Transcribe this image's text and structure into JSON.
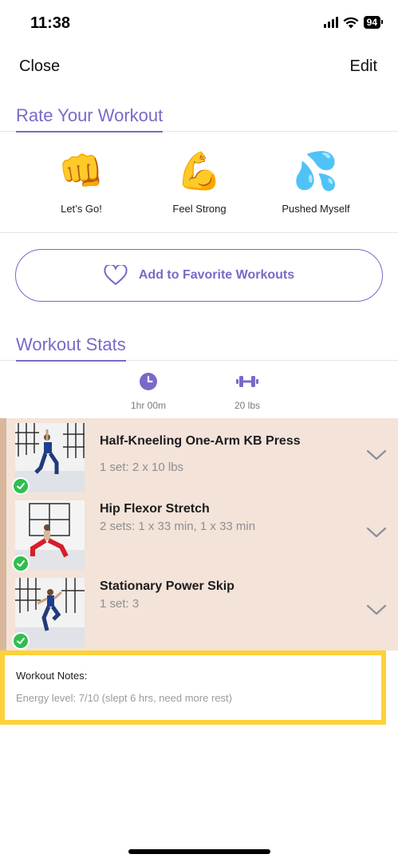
{
  "status_bar": {
    "time": "11:38",
    "battery": "94"
  },
  "nav": {
    "close_label": "Close",
    "edit_label": "Edit"
  },
  "rate_section": {
    "title": "Rate Your Workout",
    "options": [
      {
        "emoji": "👊",
        "label": "Let’s Go!"
      },
      {
        "emoji": "💪",
        "label": "Feel Strong"
      },
      {
        "emoji": "💦",
        "label": "Pushed Myself"
      }
    ]
  },
  "favorite_button": {
    "label": "Add to Favorite Workouts",
    "icon": "heart-outline-icon"
  },
  "stats_section": {
    "title": "Workout Stats",
    "stats": [
      {
        "icon": "clock-icon",
        "value": "1hr 00m"
      },
      {
        "icon": "dumbbell-icon",
        "value": "20 lbs"
      }
    ]
  },
  "exercises": [
    {
      "name": "Half-Kneeling One-Arm KB Press",
      "sets": "1 set: 2 x 10 lbs",
      "completed": true
    },
    {
      "name": "Hip Flexor Stretch",
      "sets": "2 sets: 1 x 33 min, 1 x 33 min",
      "completed": true
    },
    {
      "name": "Stationary Power Skip",
      "sets": "1 set: 3",
      "completed": true
    }
  ],
  "notes": {
    "title": "Workout Notes:",
    "text": "Energy level: 7/10 (slept 6 hrs, need more rest)"
  },
  "colors": {
    "accent": "#7b68c8",
    "exercise_bg": "#f3e3d8",
    "highlight": "#fdd238",
    "check": "#2fbf4f"
  }
}
